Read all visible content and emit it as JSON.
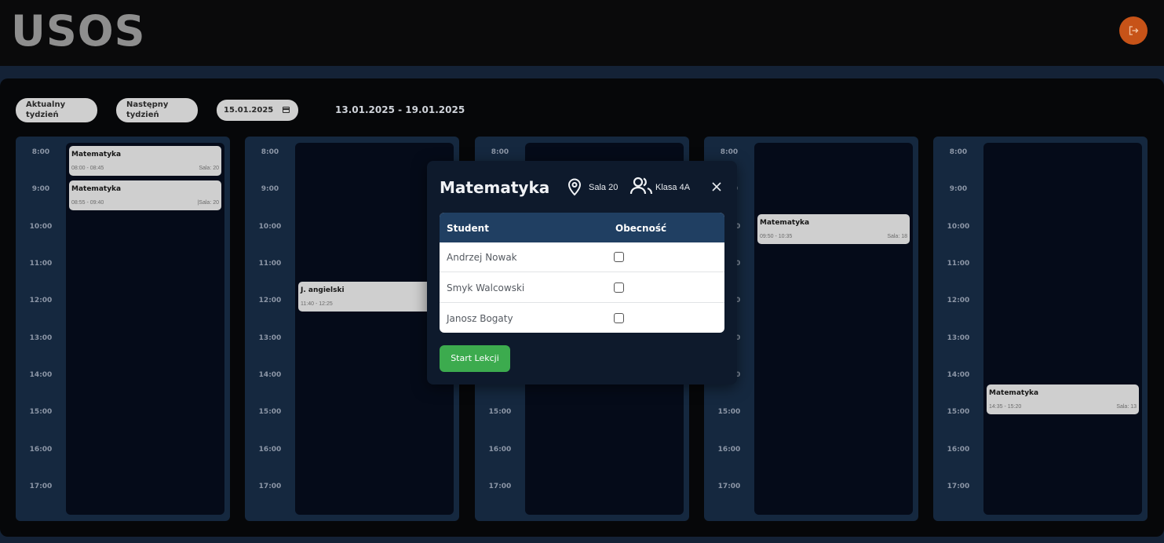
{
  "header": {
    "logo": "USOS",
    "logout_icon": "logout-icon",
    "accent_color": "#c75318"
  },
  "toolbar": {
    "current_week_line1": "Aktualny",
    "current_week_line2": "tydzień",
    "next_week_line1": "Następny",
    "next_week_line2": "tydzień",
    "date_value": "15.01.2025",
    "week_range": "13.01.2025 - 19.01.2025"
  },
  "hours": [
    "8:00",
    "9:00",
    "10:00",
    "11:00",
    "12:00",
    "13:00",
    "14:00",
    "15:00",
    "16:00",
    "17:00"
  ],
  "days": [
    {
      "events": [
        {
          "title": "Matematyka",
          "time": "08:00 - 08:45",
          "room": "Sala: 20"
        },
        {
          "title": "Matematyka",
          "time": "08:55 - 09:40",
          "room": "|Sala: 20"
        }
      ]
    },
    {
      "events": [
        {
          "title": "J. angielski",
          "time": "11:40 - 12:25",
          "room": "S"
        }
      ]
    },
    {
      "events": []
    },
    {
      "events": [
        {
          "title": "Matematyka",
          "time": "09:50 - 10:35",
          "room": "Sala: 18"
        }
      ]
    },
    {
      "events": [
        {
          "title": "Matematyka",
          "time": "14:35 - 15:20",
          "room": "Sala: 13"
        }
      ]
    }
  ],
  "modal": {
    "title": "Matematyka",
    "room": "Sala 20",
    "class": "Klasa 4A",
    "table": {
      "headers": [
        "Student",
        "Obecność"
      ],
      "rows": [
        {
          "name": "Andrzej Nowak",
          "present": false
        },
        {
          "name": "Smyk Walcowski",
          "present": false
        },
        {
          "name": "Janosz Bogaty",
          "present": false
        }
      ]
    },
    "start_label": "Start Lekcji",
    "start_color": "#3cab4e"
  }
}
